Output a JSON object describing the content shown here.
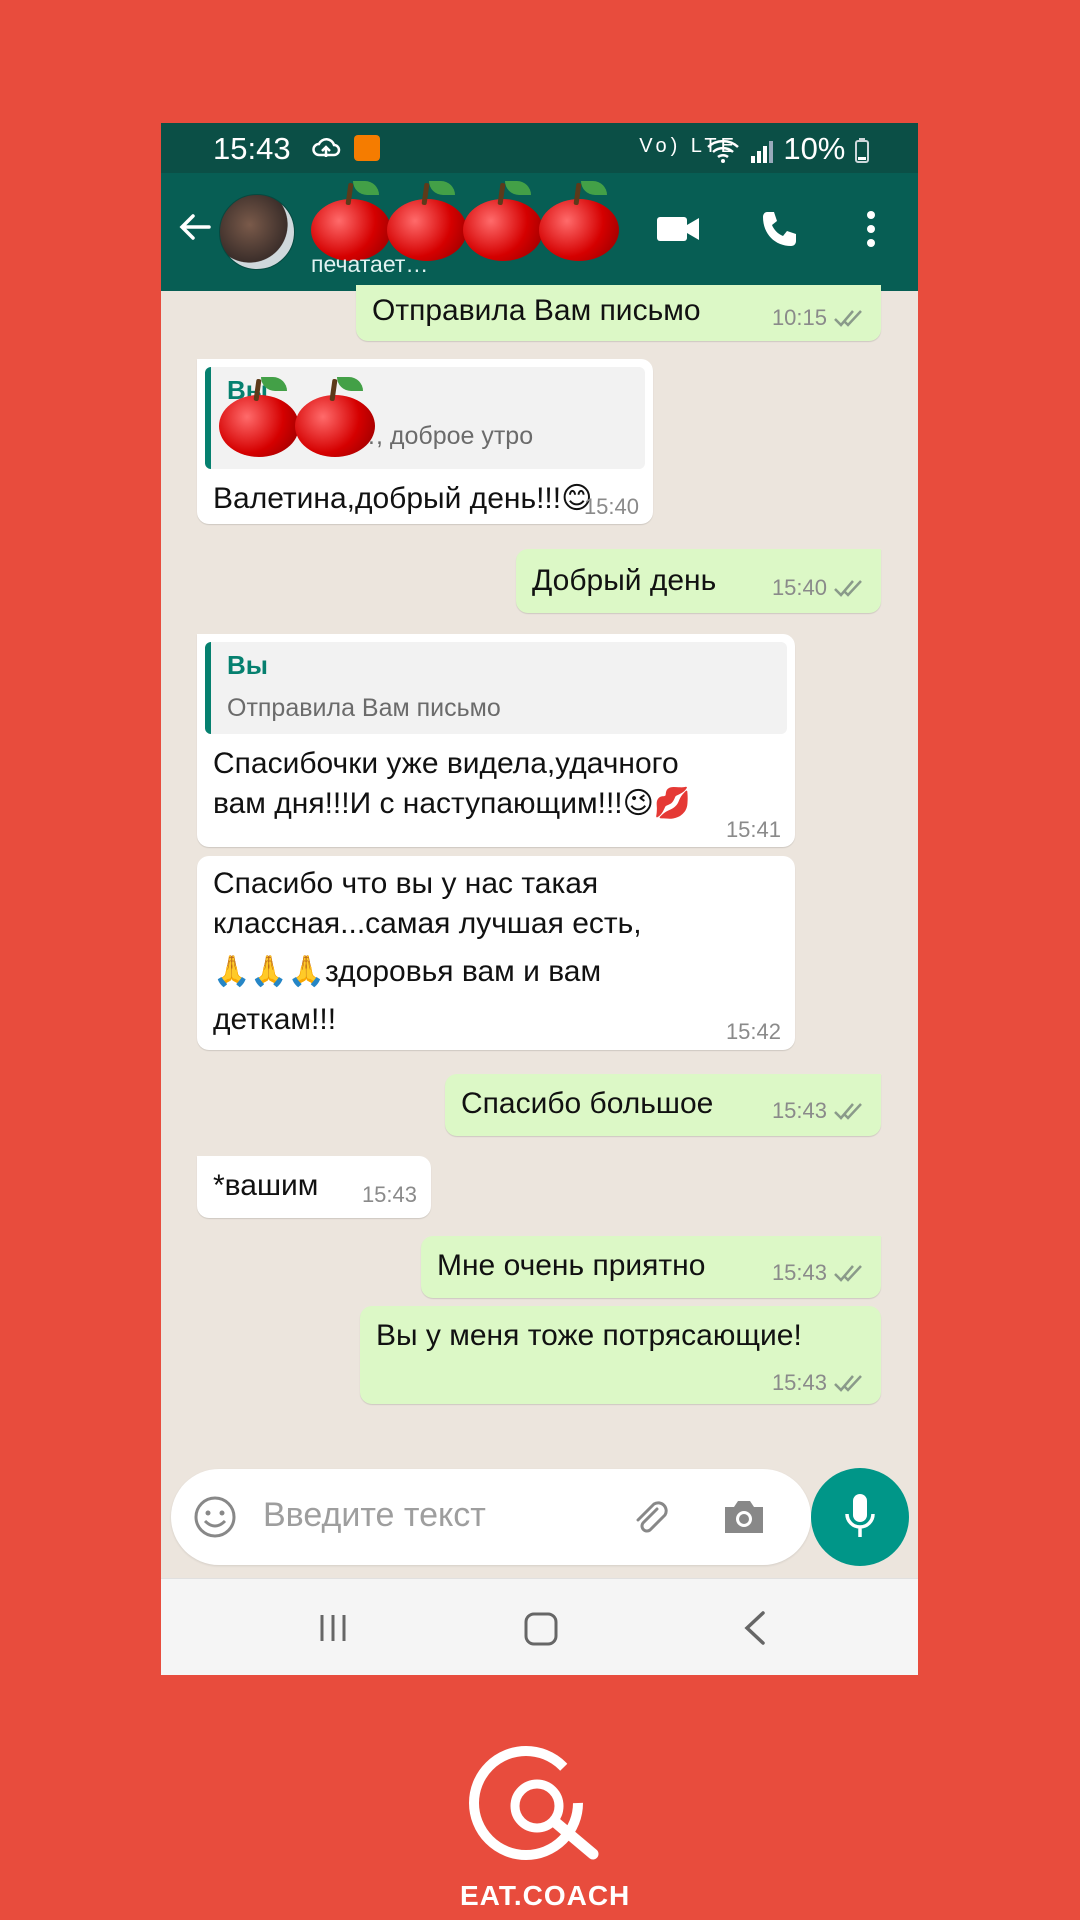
{
  "status_bar": {
    "time": "15:43",
    "battery": "10%",
    "network": "Vo) LTE"
  },
  "header": {
    "contact_name": "",
    "typing_status": "печатает…",
    "icons": [
      "back-arrow-icon",
      "video-call-icon",
      "phone-icon",
      "more-vert-icon"
    ]
  },
  "messages": [
    {
      "id": 1,
      "direction": "out",
      "text": "Отправила Вам письмо",
      "time": "10:15",
      "read": true
    },
    {
      "id": 2,
      "direction": "in",
      "quote_name": "Вы",
      "quote_text": "…, доброе утро",
      "text": "Валетина,добрый день!!!😊",
      "time": "15:40"
    },
    {
      "id": 3,
      "direction": "out",
      "text": "Добрый день",
      "time": "15:40",
      "read": true
    },
    {
      "id": 4,
      "direction": "in",
      "quote_name": "Вы",
      "quote_text": "Отправила Вам письмо",
      "text_line1": "Спасибочки уже видела,удачного",
      "text_line2": "вам дня!!!И с наступающим!!!😉💋",
      "time": "15:41"
    },
    {
      "id": 5,
      "direction": "in",
      "text_line1": "Спасибо что вы у нас такая",
      "text_line2": "классная...самая лучшая есть,",
      "text_line3": "🙏🙏🙏здоровья вам и вам",
      "text_line4": "деткам!!!",
      "time": "15:42"
    },
    {
      "id": 6,
      "direction": "out",
      "text": "Спасибо большое",
      "time": "15:43",
      "read": true
    },
    {
      "id": 7,
      "direction": "in",
      "text": "*вашим",
      "time": "15:43"
    },
    {
      "id": 8,
      "direction": "out",
      "text": "Мне очень приятно",
      "time": "15:43",
      "read": true
    },
    {
      "id": 9,
      "direction": "out",
      "text": "Вы у меня тоже потрясающие!",
      "time": "15:43",
      "read": true
    }
  ],
  "composer": {
    "placeholder": "Введите текст",
    "icons": [
      "emoji-icon",
      "attach-icon",
      "camera-icon",
      "mic-icon"
    ]
  },
  "nav": {
    "icons": [
      "recent-apps-icon",
      "home-icon",
      "back-icon"
    ]
  },
  "brand": {
    "logo_text": "EAT.COACH"
  },
  "colors": {
    "header": "#075e54",
    "outgoing": "#dcf8c6",
    "incoming": "#ffffff",
    "background": "#e84c3d",
    "accent": "#009688"
  }
}
